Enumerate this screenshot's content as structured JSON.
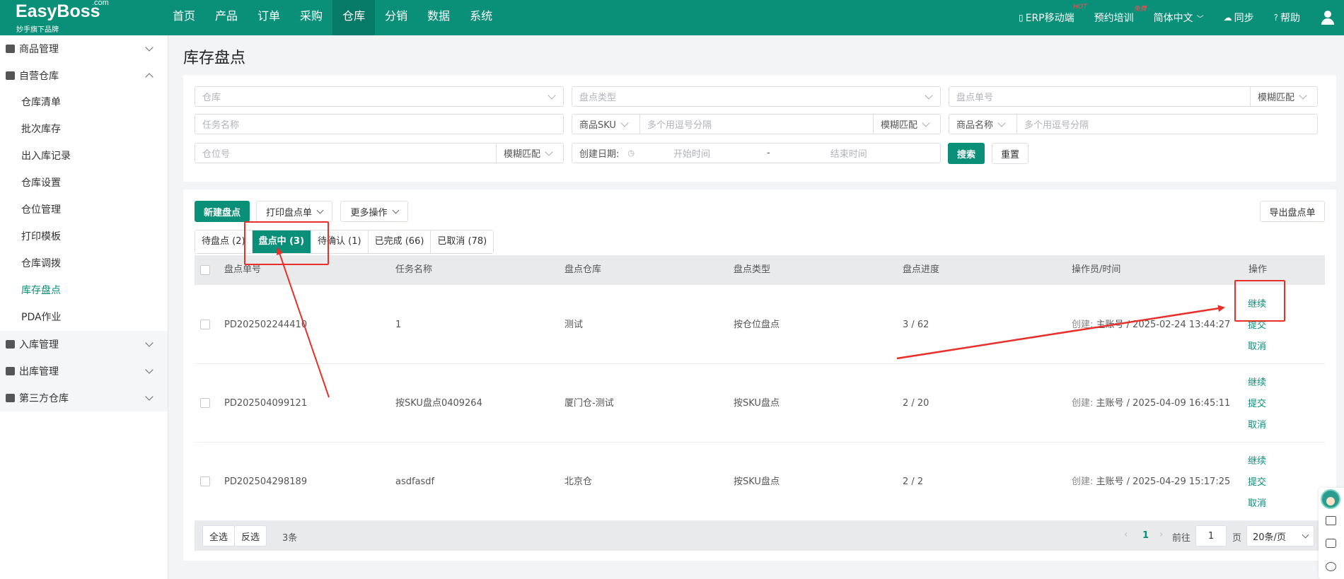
{
  "brand": {
    "name": "EasyBoss",
    "com": ".com",
    "tagline": "妙手旗下品牌"
  },
  "nav": [
    "首页",
    "产品",
    "订单",
    "采购",
    "仓库",
    "分销",
    "数据",
    "系统"
  ],
  "nav_active": "仓库",
  "top_right": {
    "erp": "ERP移动端",
    "erp_badge": "HOT",
    "training": "预约培训",
    "training_badge": "免费",
    "language": "简体中文",
    "sync": "同步",
    "help": "帮助"
  },
  "sidebar": {
    "goods": "商品管理",
    "own_warehouse": "自营仓库",
    "sub_items": [
      "仓库清单",
      "批次库存",
      "出入库记录",
      "仓库设置",
      "仓位管理",
      "打印模板",
      "仓库调拨",
      "库存盘点",
      "PDA作业"
    ],
    "active_sub": "库存盘点",
    "inbound": "入库管理",
    "outbound": "出库管理",
    "third_party": "第三方仓库"
  },
  "page_title": "库存盘点",
  "filters": {
    "warehouse": "仓库",
    "check_type": "盘点类型",
    "check_no": "盘点单号",
    "fuzzy": "模糊匹配",
    "task_name": "任务名称",
    "sku_label": "商品SKU",
    "multi_comma": "多个用逗号分隔",
    "goods_name": "商品名称",
    "bin_no": "仓位号",
    "create_date": "创建日期:",
    "start_time": "开始时间",
    "dash": "-",
    "end_time": "结束时间",
    "search": "搜索",
    "reset": "重置"
  },
  "toolbar": {
    "new": "新建盘点",
    "print": "打印盘点单",
    "more": "更多操作",
    "export": "导出盘点单"
  },
  "tabs": [
    "待盘点 (2)",
    "盘点中 (3)",
    "待确认 (1)",
    "已完成 (66)",
    "已取消 (78)"
  ],
  "tab_active": "盘点中 (3)",
  "columns": [
    "盘点单号",
    "任务名称",
    "盘点仓库",
    "盘点类型",
    "盘点进度",
    "操作员/时间",
    "操作"
  ],
  "rows": [
    {
      "no": "PD202502244410",
      "task": "1",
      "warehouse": "测试",
      "type": "按仓位盘点",
      "progress": "3 / 62",
      "created_label": "创建:",
      "operator": "主账号 / 2025-02-24 13:44:27"
    },
    {
      "no": "PD202504099121",
      "task": "按SKU盘点0409264",
      "warehouse": "厦门仓-测试",
      "type": "按SKU盘点",
      "progress": "2 / 20",
      "created_label": "创建:",
      "operator": "主账号 / 2025-04-09 16:45:11"
    },
    {
      "no": "PD202504298189",
      "task": "asdfasdf",
      "warehouse": "北京仓",
      "type": "按SKU盘点",
      "progress": "2 / 2",
      "created_label": "创建:",
      "operator": "主账号 / 2025-04-29 15:17:25"
    }
  ],
  "row_ops": [
    "继续",
    "提交",
    "取消"
  ],
  "footer": {
    "select_all": "全选",
    "invert": "反选",
    "count": "3条",
    "page": "1",
    "goto": "前往",
    "goto_value": "1",
    "page_unit": "页",
    "page_size": "20条/页"
  },
  "colors": {
    "primary": "#0a8f78",
    "annotation": "#e8302a"
  }
}
